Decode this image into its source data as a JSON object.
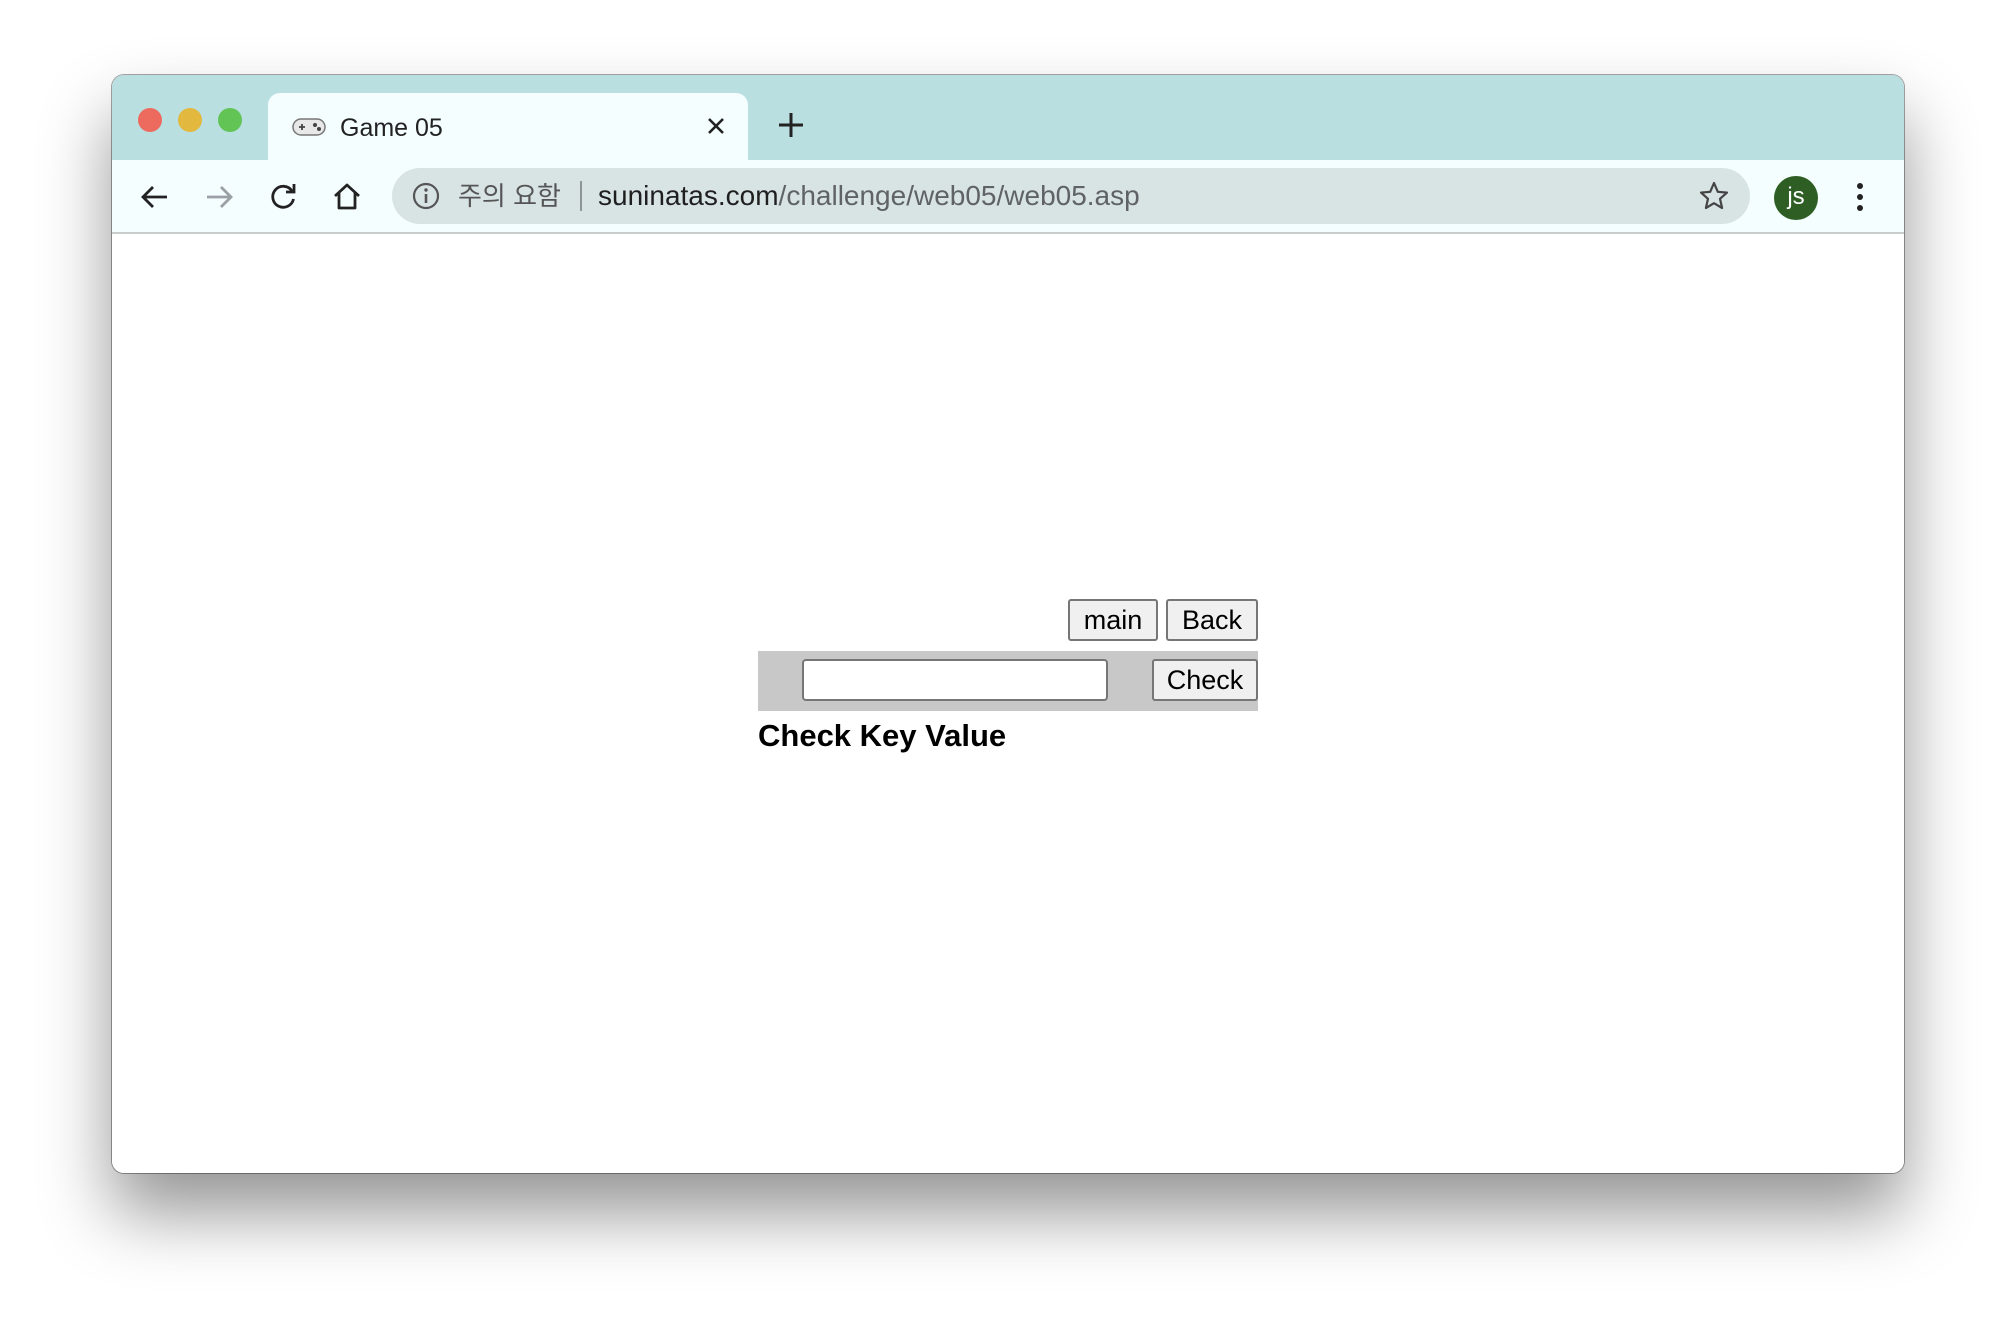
{
  "browser": {
    "tab": {
      "title": "Game 05",
      "favicon": "gamepad-icon"
    },
    "toolbar": {
      "security_label": "주의 요함",
      "url_host": "suninatas.com",
      "url_path": "/challenge/web05/web05.asp",
      "profile_initials": "js"
    },
    "colors": {
      "titlebar": "#b9dfe0",
      "toolbar": "#f4fefe",
      "avatar": "#2e5e24"
    }
  },
  "page": {
    "main_label": "main",
    "back_label": "Back",
    "check_label": "Check",
    "key_input_value": "",
    "status_text": "Check Key Value"
  }
}
